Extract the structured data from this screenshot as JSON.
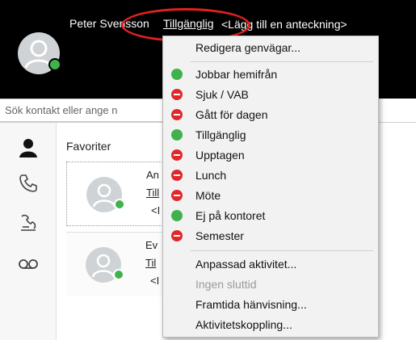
{
  "header": {
    "user_name": "Peter Svensson",
    "status_label": "Tillgänglig",
    "note_link": "<Lägg till en anteckning>"
  },
  "search": {
    "placeholder": "Sök kontakt eller ange n"
  },
  "sidebar": {
    "items": [
      {
        "icon": "person-icon"
      },
      {
        "icon": "phone-icon"
      },
      {
        "icon": "call-log-icon"
      },
      {
        "icon": "voicemail-icon"
      }
    ]
  },
  "main": {
    "group_title": "Favoriter",
    "contacts": [
      {
        "name": "An",
        "status": "Till",
        "note": "<I"
      },
      {
        "name": "Ev",
        "status": "Til",
        "note": "<I"
      }
    ]
  },
  "menu": {
    "edit_shortcuts": "Redigera genvägar...",
    "statuses": [
      {
        "label": "Jobbar hemifrån",
        "color": "green"
      },
      {
        "label": "Sjuk / VAB",
        "color": "red"
      },
      {
        "label": "Gått för dagen",
        "color": "red"
      },
      {
        "label": "Tillgänglig",
        "color": "green"
      },
      {
        "label": "Upptagen",
        "color": "red"
      },
      {
        "label": "Lunch",
        "color": "red"
      },
      {
        "label": "Möte",
        "color": "red"
      },
      {
        "label": "Ej på kontoret",
        "color": "green"
      },
      {
        "label": "Semester",
        "color": "red"
      }
    ],
    "custom_activity": "Anpassad aktivitet...",
    "no_end_time": "Ingen sluttid",
    "future_referral": "Framtida hänvisning...",
    "activity_link": "Aktivitetskoppling..."
  },
  "colors": {
    "available_green": "#3fb24b",
    "busy_red": "#e0282b",
    "highlight_ellipse": "#e02020"
  }
}
